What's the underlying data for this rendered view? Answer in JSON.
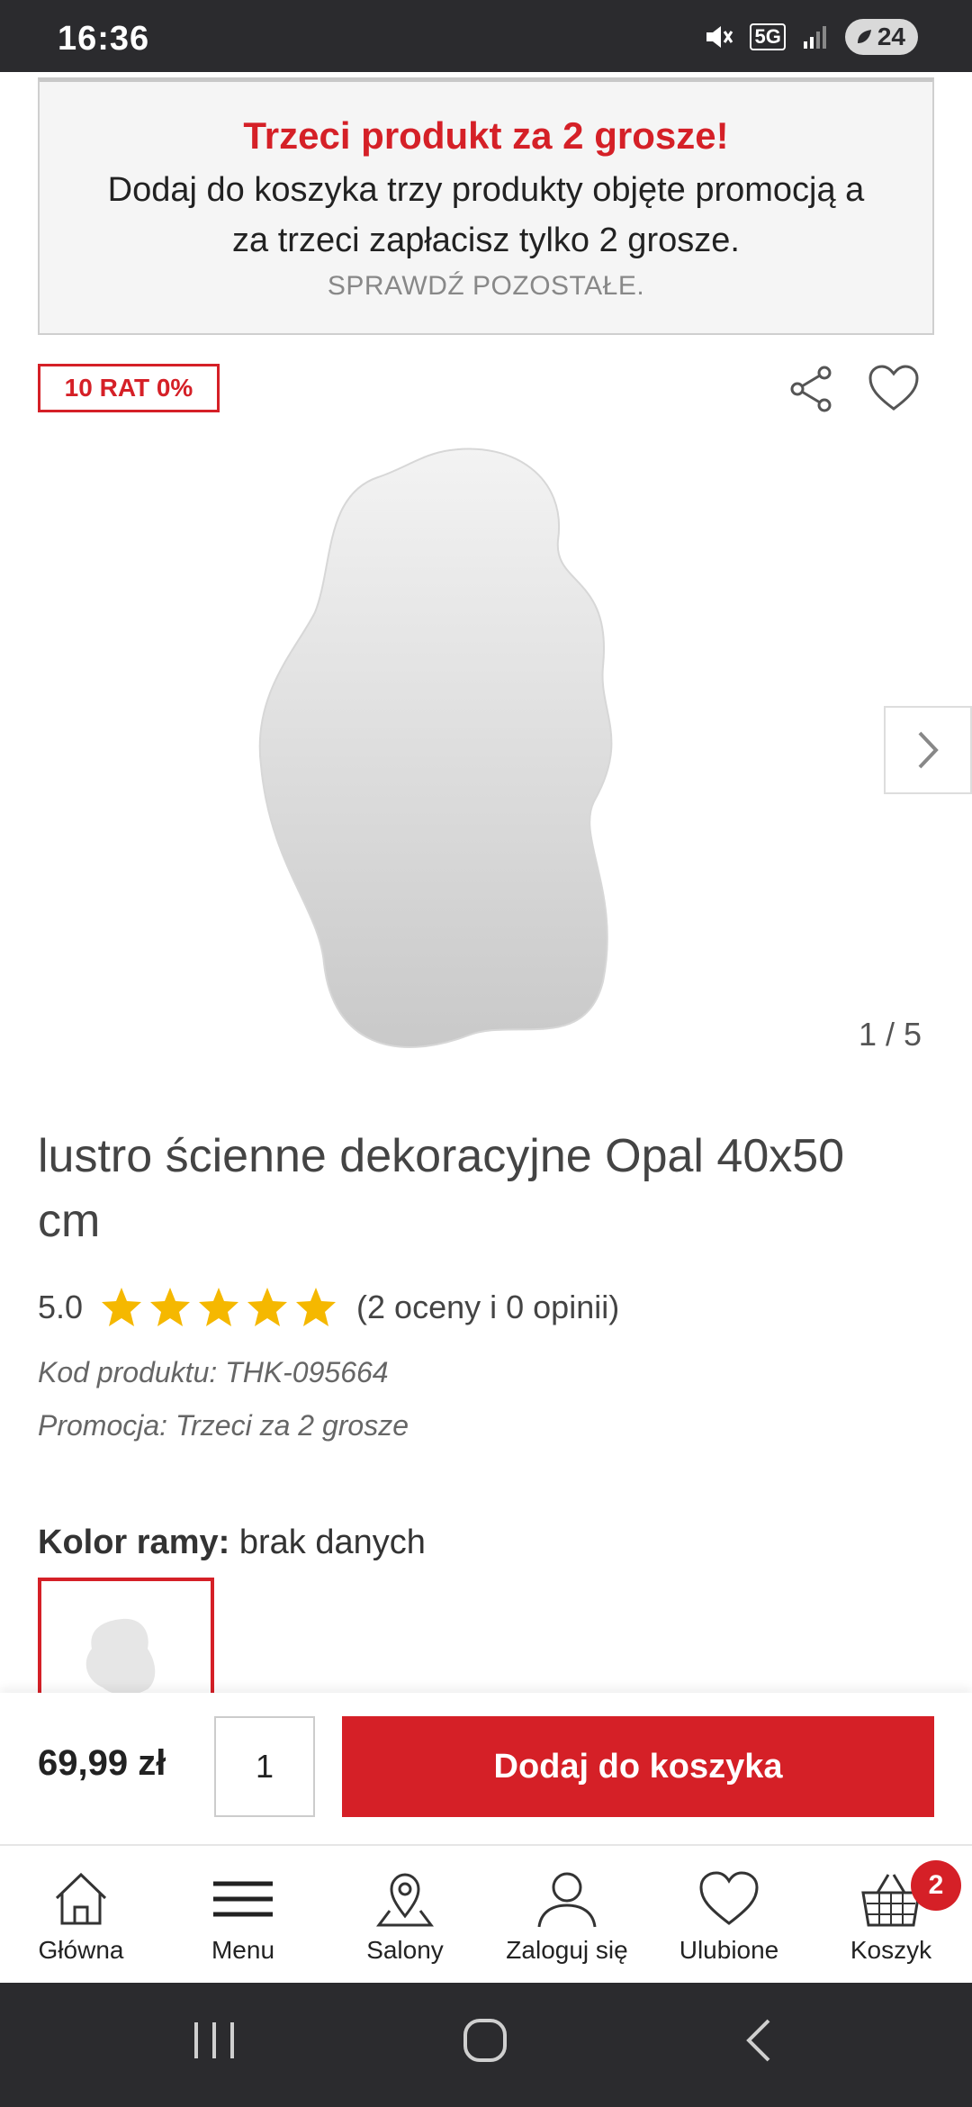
{
  "status_bar": {
    "time": "16:36",
    "network": "5G",
    "battery": "24"
  },
  "promo": {
    "title": "Trzeci produkt za 2 grosze!",
    "text": "Dodaj do koszyka trzy produkty objęte promocją a za trzeci zapłacisz tylko 2 grosze.",
    "link": "SPRAWDŹ POZOSTAŁE."
  },
  "badge": "10 RAT 0%",
  "gallery": {
    "pager": "1 / 5"
  },
  "product": {
    "title": "lustro ścienne dekoracyjne Opal 40x50 cm",
    "rating": "5.0",
    "stars": 5,
    "reviews": "(2 oceny i 0 opinii)",
    "code": "Kod produktu: THK-095664",
    "promotion": "Promocja: Trzeci za 2 grosze",
    "color_label": "Kolor ramy:",
    "color_value": "brak danych"
  },
  "buy": {
    "price": "69,99 zł",
    "quantity": "1",
    "add_label": "Dodaj do koszyka"
  },
  "nav": {
    "items": [
      {
        "label": "Główna",
        "icon": "home-icon"
      },
      {
        "label": "Menu",
        "icon": "menu-icon"
      },
      {
        "label": "Salony",
        "icon": "location-icon"
      },
      {
        "label": "Zaloguj się",
        "icon": "user-icon"
      },
      {
        "label": "Ulubione",
        "icon": "heart-icon"
      },
      {
        "label": "Koszyk",
        "icon": "basket-icon"
      }
    ],
    "cart_count": "2"
  },
  "colors": {
    "accent": "#d52027",
    "star": "#f5b800",
    "system_bar": "#2b2b2e"
  }
}
